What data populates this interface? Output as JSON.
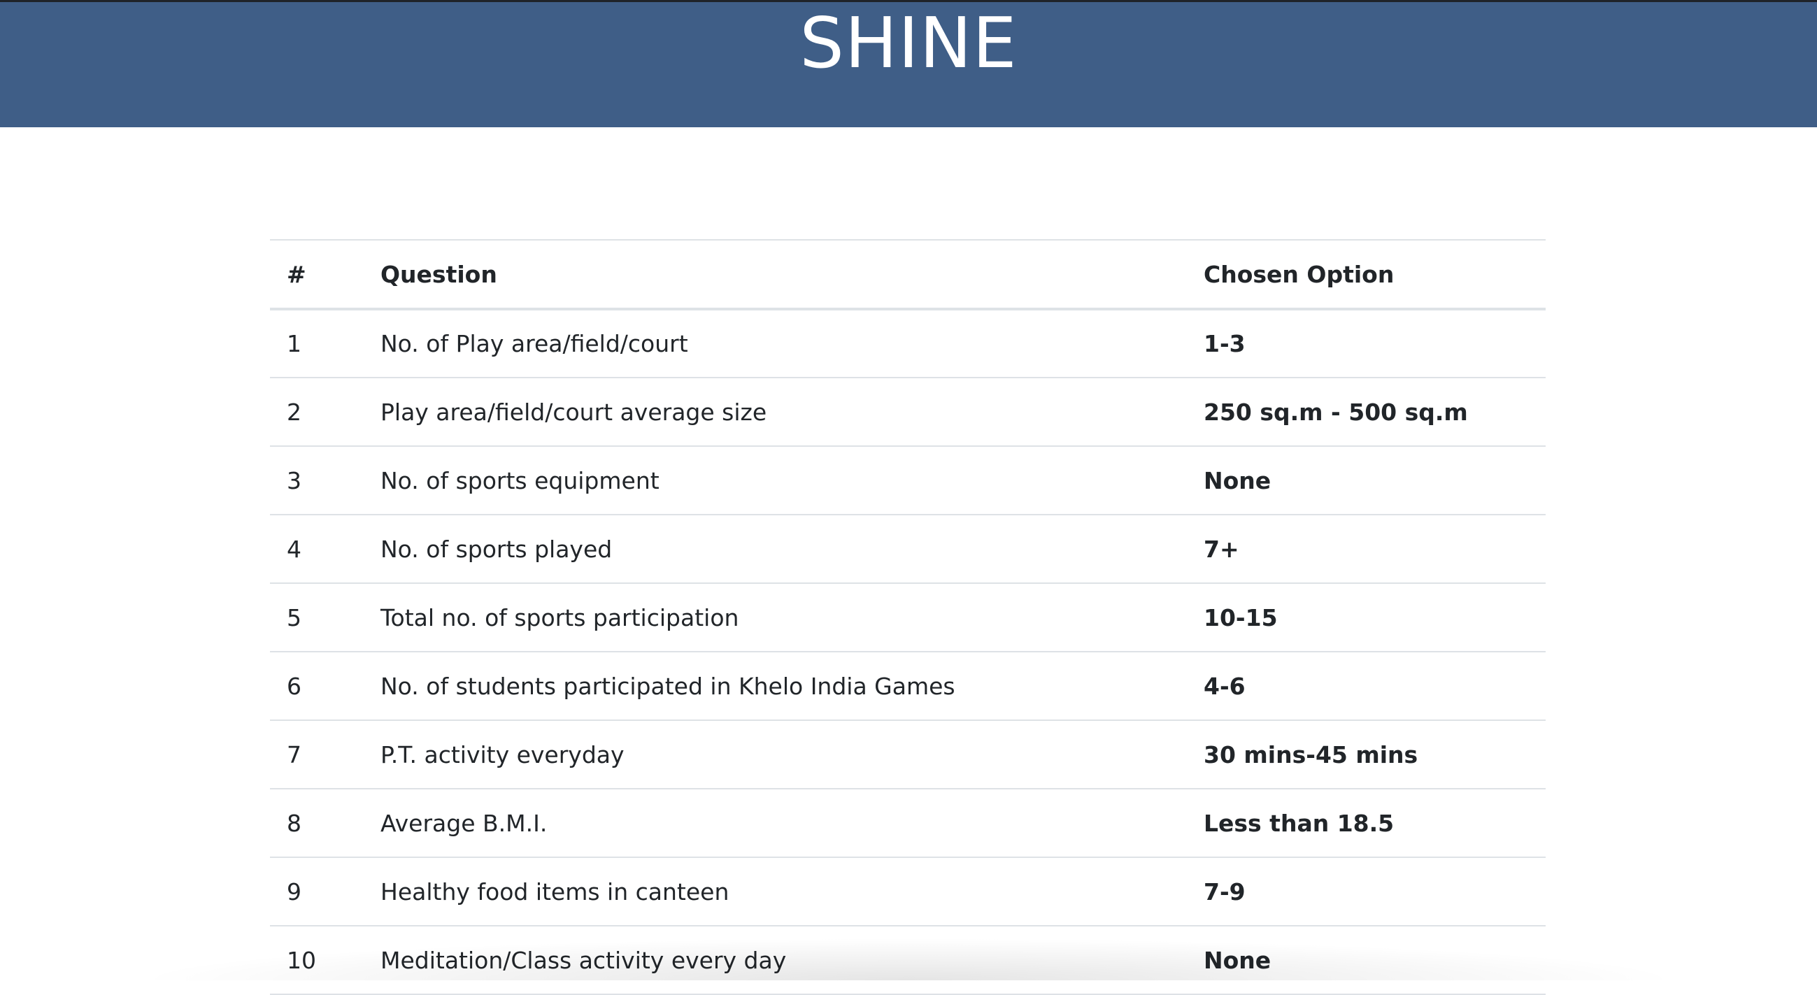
{
  "header": {
    "title": "SHINE",
    "background_color": "#3f5e87"
  },
  "table": {
    "columns": [
      "#",
      "Question",
      "Chosen Option"
    ],
    "rows": [
      {
        "num": "1",
        "question": "No. of Play area/field/court",
        "option": "1-3"
      },
      {
        "num": "2",
        "question": "Play area/field/court average size",
        "option": "250 sq.m - 500 sq.m"
      },
      {
        "num": "3",
        "question": "No. of sports equipment",
        "option": "None"
      },
      {
        "num": "4",
        "question": "No. of sports played",
        "option": "7+"
      },
      {
        "num": "5",
        "question": "Total no. of sports participation",
        "option": "10-15"
      },
      {
        "num": "6",
        "question": "No. of students participated in Khelo India Games",
        "option": "4-6"
      },
      {
        "num": "7",
        "question": "P.T. activity everyday",
        "option": "30 mins-45 mins"
      },
      {
        "num": "8",
        "question": "Average B.M.I.",
        "option": "Less than 18.5"
      },
      {
        "num": "9",
        "question": "Healthy food items in canteen",
        "option": "7-9"
      },
      {
        "num": "10",
        "question": "Meditation/Class activity every day",
        "option": "None"
      }
    ]
  }
}
